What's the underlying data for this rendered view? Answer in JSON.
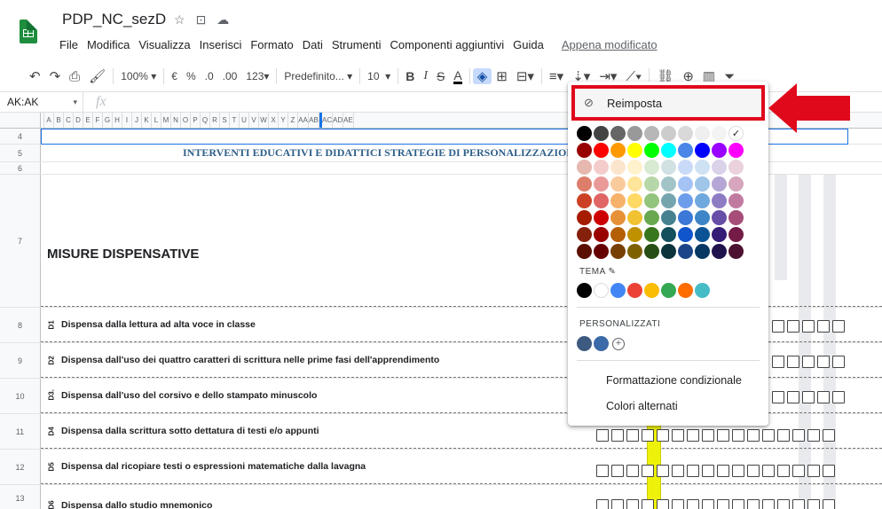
{
  "title": {
    "doc_name": "PDP_NC_sezD",
    "star_icon": "☆",
    "folder_icon": "⊡",
    "cloud_icon": "☁"
  },
  "menu": [
    "File",
    "Modifica",
    "Visualizza",
    "Inserisci",
    "Formato",
    "Dati",
    "Strumenti",
    "Componenti aggiuntivi",
    "Guida"
  ],
  "last_edit": "Appena modificato",
  "toolbar": {
    "zoom": "100%",
    "currency": "€",
    "percent": "%",
    "dec_less": ".0",
    "dec_more": ".00",
    "format_more": "123",
    "font": "Predefinito...",
    "font_size": "10",
    "bold": "B",
    "italic": "I",
    "strike": "S",
    "text_color": "A"
  },
  "formula": {
    "namebox": "AK:AK",
    "fx": "fx"
  },
  "columns": [
    "A",
    "B",
    "C",
    "D",
    "E",
    "F",
    "G",
    "H",
    "I",
    "J",
    "K",
    "L",
    "M",
    "N",
    "O",
    "P",
    "Q",
    "R",
    "S",
    "T",
    "U",
    "V",
    "W",
    "X",
    "Y",
    "Z",
    "AA",
    "AB",
    "AC",
    "AD",
    "AE"
  ],
  "rows": {
    "r4": "4",
    "r5": "5",
    "r6": "6",
    "r7": "7",
    "r8": "8",
    "r9": "9",
    "r10": "10",
    "r11": "11",
    "r12": "12",
    "r13": "13",
    "heading": "INTERVENTI EDUCATIVI E DIDATTICI STRATEGIE DI PERSONALIZZAZIONE",
    "misure": "MISURE DISPENSATIVE",
    "items": [
      {
        "code": "D1",
        "text": "Dispensa dalla lettura ad alta voce in classe"
      },
      {
        "code": "D2",
        "text": "Dispensa dall'uso dei quattro caratteri di scrittura nelle prime fasi dell'apprendimento"
      },
      {
        "code": "D3.",
        "text": "Dispensa dall'uso del corsivo e dello stampato minuscolo"
      },
      {
        "code": "D4",
        "text": "Dispensa dalla scrittura sotto dettatura di testi e/o appunti"
      },
      {
        "code": "D5",
        "text": "Dispensa dal ricopiare testi o espressioni matematiche dalla lavagna"
      },
      {
        "code": "D6",
        "text": "Dispensa dallo studio mnemonico"
      }
    ]
  },
  "palette": {
    "reset_label": "Reimposta",
    "tema_label": "TEMA",
    "personalizzati_label": "PERSONALIZZATI",
    "conditional_label": "Formattazione condizionale",
    "alternating_label": "Colori alternati",
    "grid": [
      [
        "#000000",
        "#434343",
        "#666666",
        "#999999",
        "#b7b7b7",
        "#cccccc",
        "#d9d9d9",
        "#efefef",
        "#f3f3f3",
        "#ffffff"
      ],
      [
        "#980000",
        "#ff0000",
        "#ff9900",
        "#ffff00",
        "#00ff00",
        "#00ffff",
        "#4a86e8",
        "#0000ff",
        "#9900ff",
        "#ff00ff"
      ],
      [
        "#e6b8af",
        "#f4cccc",
        "#fce5cd",
        "#fff2cc",
        "#d9ead3",
        "#d0e0e3",
        "#c9daf8",
        "#cfe2f3",
        "#d9d2e9",
        "#ead1dc"
      ],
      [
        "#dd7e6b",
        "#ea9999",
        "#f9cb9c",
        "#ffe599",
        "#b6d7a8",
        "#a2c4c9",
        "#a4c2f4",
        "#9fc5e8",
        "#b4a7d6",
        "#d5a6bd"
      ],
      [
        "#cc4125",
        "#e06666",
        "#f6b26b",
        "#ffd966",
        "#93c47d",
        "#76a5af",
        "#6d9eeb",
        "#6fa8dc",
        "#8e7cc3",
        "#c27ba0"
      ],
      [
        "#a61c00",
        "#cc0000",
        "#e69138",
        "#f1c232",
        "#6aa84f",
        "#45818e",
        "#3c78d8",
        "#3d85c6",
        "#674ea7",
        "#a64d79"
      ],
      [
        "#85200c",
        "#990000",
        "#b45f06",
        "#bf9000",
        "#38761d",
        "#134f5c",
        "#1155cc",
        "#0b5394",
        "#351c75",
        "#741b47"
      ],
      [
        "#5b0f00",
        "#660000",
        "#783f04",
        "#7f6000",
        "#274e13",
        "#0c343d",
        "#1c4587",
        "#073763",
        "#20124d",
        "#4c1130"
      ]
    ],
    "theme": [
      "#000000",
      "#ffffff",
      "#4285f4",
      "#ea4335",
      "#fbbc04",
      "#34a853",
      "#ff6d01",
      "#46bdc6"
    ],
    "custom": [
      "#3d5a80",
      "#3b6aa8"
    ]
  },
  "colors": {
    "accent": "#1a73e8",
    "highlight": "#e0091b",
    "yellow": "#eef20a"
  }
}
